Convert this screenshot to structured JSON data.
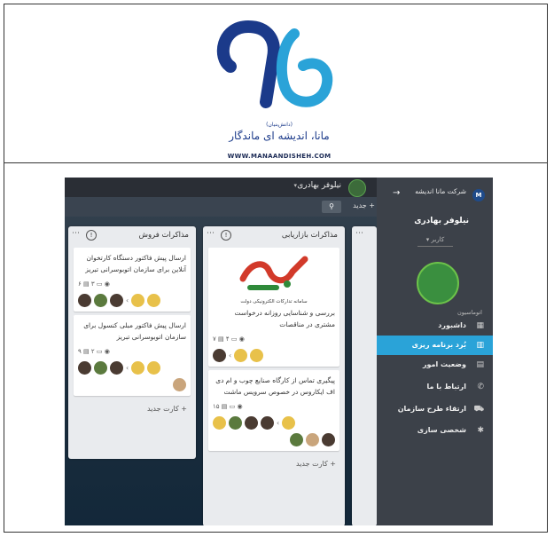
{
  "logo": {
    "subtitle": "(دانش‌بنیان)",
    "brand": "مانا، اندیشه ای ماندگار",
    "url": "WWW.MANAANDISHEH.COM",
    "colors": {
      "primary": "#1b3a8a",
      "accent": "#2aa3d8"
    }
  },
  "topbar": {
    "user_name": "نیلوفر بهادری",
    "caret": "▾",
    "search_icon": "search-icon",
    "add_new_label": "+ جدید"
  },
  "columns": [
    {
      "title": "مذاکرات فروش",
      "cards": [
        {
          "text": "ارسال پیش فاکتور دستگاه کارتخوان آنلاین برای سازمان اتوبوسرانی تبریز",
          "meta": [
            "۶",
            "▤",
            "۳",
            "▭",
            "◉"
          ]
        },
        {
          "text": "ارسال پیش فاکتور مبلی کنسول برای سازمان اتوبوسرانی تبریز",
          "meta": [
            "۹",
            "▤",
            "۲",
            "▭",
            "◉"
          ]
        }
      ],
      "add_label": "+ کارت جدید"
    },
    {
      "title": "مذاکرات بازاریابی",
      "cards": [
        {
          "text": "بررسی و شناسایی روزانه درخواست مشتری در مناقصات",
          "meta": [
            "۷",
            "▤",
            "۴",
            "▭",
            "◉"
          ],
          "image_caption": "سامانه تداركات الكترونيكی دولت"
        },
        {
          "text": "پیگیری تماس از کارگاه صنایع چوب و ام دی اف ایکاروس در خصوص سرویس ماشت",
          "meta": [
            "۱۵",
            "▤",
            "▭",
            "◉"
          ]
        }
      ],
      "add_label": "+ کارت جدید"
    }
  ],
  "sidebar": {
    "company": "شرکت مانا اندیشه",
    "logo_letter": "M",
    "user_name": "نیلوفر بهادری",
    "role": "کاربر",
    "section": "اتوماسیون",
    "items": [
      {
        "label": "داشبورد",
        "icon": "dashboard-icon",
        "glyph": "▦",
        "active": false
      },
      {
        "label": "بُرد برنامه ریزی",
        "icon": "board-icon",
        "glyph": "▥",
        "active": true
      },
      {
        "label": "وضعیت امور",
        "icon": "status-icon",
        "glyph": "▤",
        "active": false
      },
      {
        "label": "ارتباط با ما",
        "icon": "contact-icon",
        "glyph": "✆",
        "active": false
      },
      {
        "label": "ارتقاء طرح سازمان",
        "icon": "cart-icon",
        "glyph": "⛟",
        "active": false
      },
      {
        "label": "شخصی سازی",
        "icon": "gear-icon",
        "glyph": "✱",
        "active": false
      }
    ]
  }
}
